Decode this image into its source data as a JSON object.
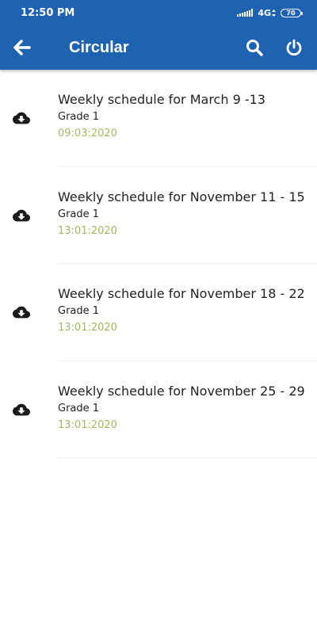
{
  "status_bar": {
    "time": "12:50 PM",
    "network": "4G",
    "battery": "70"
  },
  "header": {
    "title": "Circular"
  },
  "icons": {
    "back": "arrow-left-icon",
    "search": "search-icon",
    "power": "power-icon",
    "download": "cloud-download-icon"
  },
  "colors": {
    "header_bg": "#1e63b1",
    "date_text": "#9dbb5a",
    "divider": "#eeeeee"
  },
  "items": [
    {
      "name": "Weekly schedule for March 9 -13",
      "grade": "Grade 1",
      "date": "09:03:2020"
    },
    {
      "name": "Weekly schedule for November 11 - 15",
      "grade": "Grade 1",
      "date": "13:01:2020"
    },
    {
      "name": "Weekly schedule for November 18 - 22",
      "grade": "Grade 1",
      "date": "13:01:2020"
    },
    {
      "name": "Weekly schedule for November 25 - 29",
      "grade": "Grade 1",
      "date": "13:01:2020"
    }
  ]
}
